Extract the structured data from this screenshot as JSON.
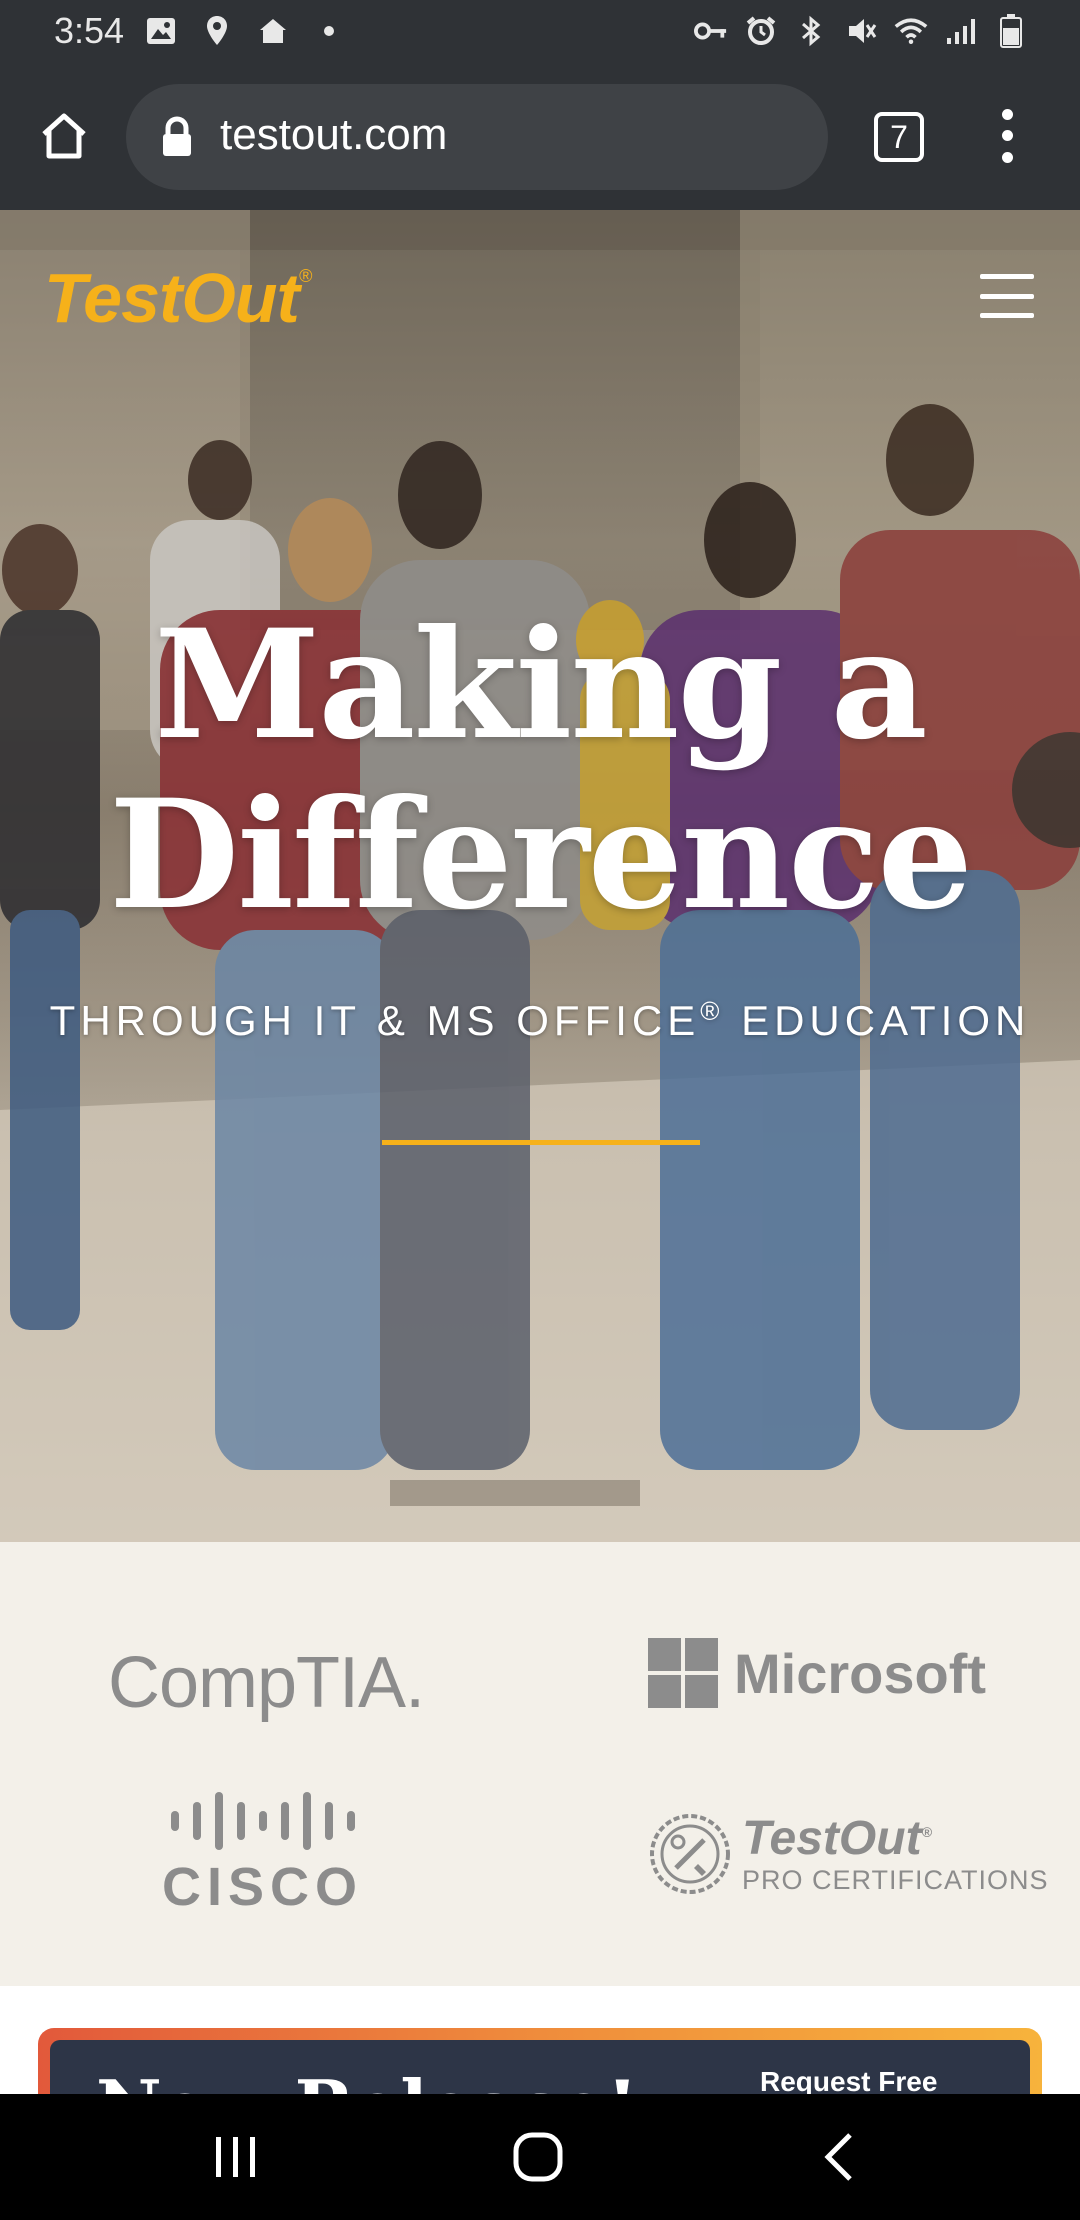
{
  "status_bar": {
    "time": "3:54",
    "left_icons": [
      "image-icon",
      "location-icon",
      "home-notification-icon",
      "dot-icon"
    ],
    "right_icons": [
      "key-icon",
      "alarm-icon",
      "bluetooth-icon",
      "mute-icon",
      "wifi-icon",
      "signal-icon",
      "battery-icon"
    ]
  },
  "browser": {
    "url": "testout.com",
    "tab_count": "7"
  },
  "hero": {
    "logo": "TestOut",
    "logo_mark": "®",
    "title_line1": "Making a",
    "title_line2": "Difference",
    "subtitle_main": "THROUGH IT & MS OFFICE",
    "subtitle_mark": "®",
    "subtitle_end": " EDUCATION",
    "accent_color": "#f6b11a"
  },
  "partners": {
    "comptia": "CompTIA.",
    "microsoft": "Microsoft",
    "cisco": "CISCO",
    "testout_pro_brand": "TestOut",
    "testout_pro_mark": "®",
    "testout_pro_sub": "PRO CERTIFICATIONS"
  },
  "release_banner": {
    "title": "New Release!",
    "button": "Request Free"
  },
  "nav_bar": {
    "buttons": [
      "recents-icon",
      "home-icon",
      "back-icon"
    ]
  }
}
